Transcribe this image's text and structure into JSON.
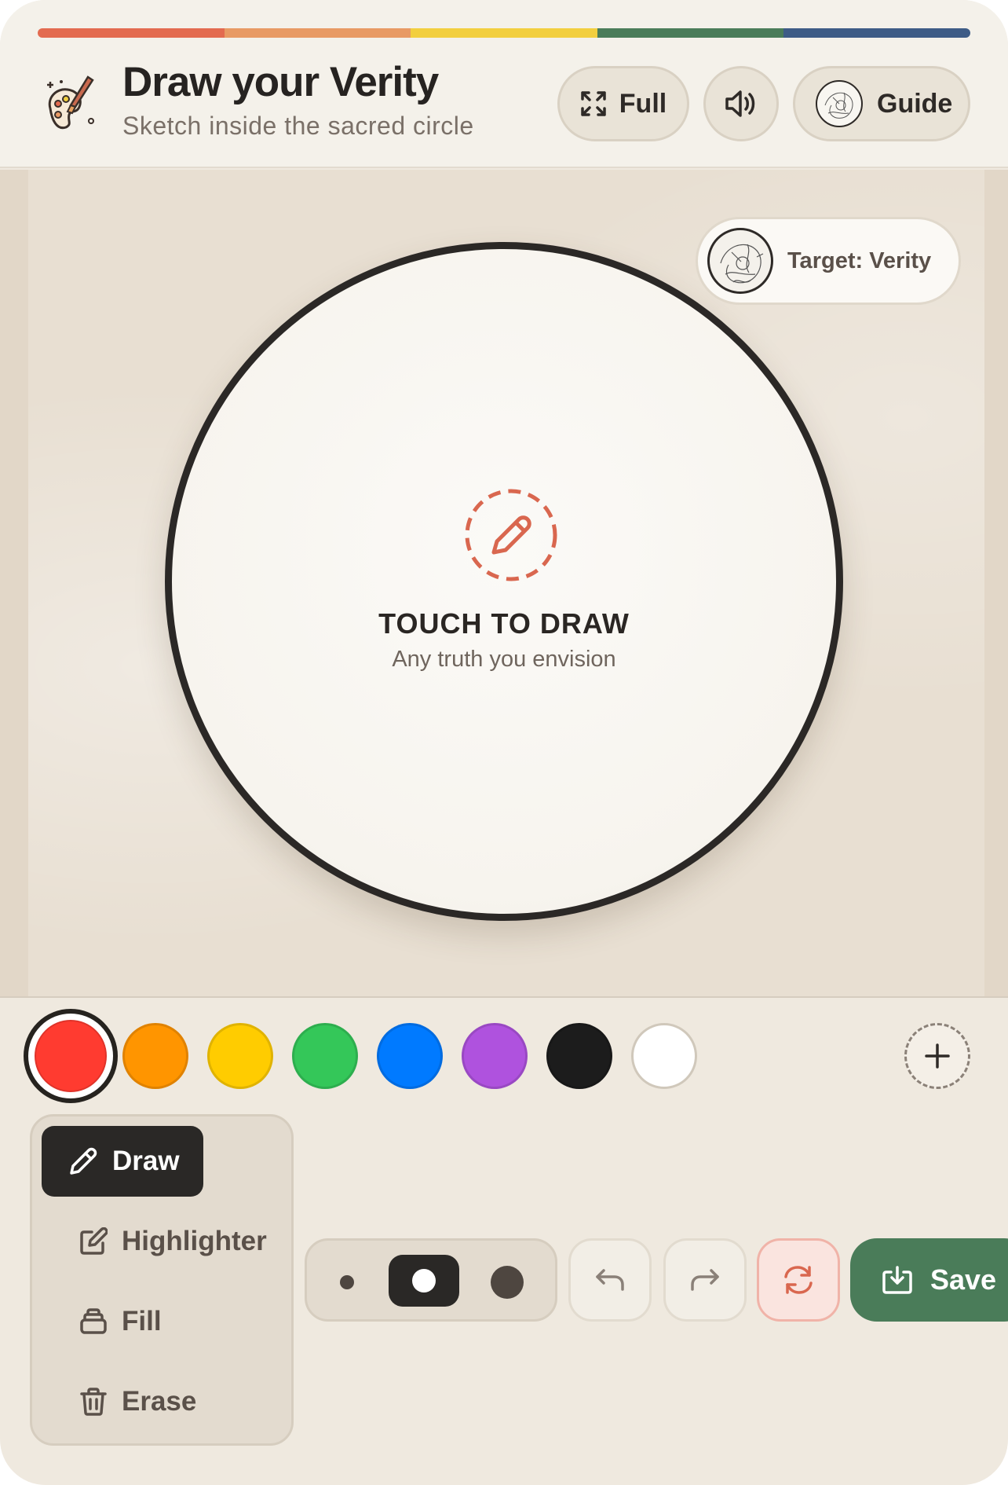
{
  "header": {
    "title": "Draw your Verity",
    "subtitle": "Sketch inside the sacred circle",
    "logo_icon": "palette-brush-icon",
    "buttons": {
      "full_label": "Full",
      "sound_icon": "speaker-icon",
      "guide_label": "Guide"
    }
  },
  "stripe_colors": [
    "#e36b50",
    "#e89a64",
    "#f2cf3f",
    "#4a7c59",
    "#3e5c86"
  ],
  "canvas": {
    "prompt_title": "TOUCH TO DRAW",
    "prompt_subtitle": "Any truth you envision",
    "prompt_icon": "pencil-icon",
    "target_label": "Target: Verity"
  },
  "palette": {
    "selected": "#ff3b30",
    "colors": [
      "#ff3b30",
      "#ff9500",
      "#ffcc00",
      "#34c759",
      "#007aff",
      "#af52de",
      "#1c1c1c",
      "#ffffff"
    ],
    "add_icon": "plus-icon"
  },
  "tools": {
    "active": "Draw",
    "items": [
      {
        "label": "Draw",
        "icon": "pencil-icon"
      },
      {
        "label": "Highlighter",
        "icon": "edit-square-icon"
      },
      {
        "label": "Fill",
        "icon": "bucket-icon"
      },
      {
        "label": "Erase",
        "icon": "trash-icon"
      }
    ]
  },
  "brush": {
    "sizes": [
      "small",
      "medium",
      "large"
    ],
    "selected": "medium"
  },
  "actions": {
    "undo_icon": "undo-icon",
    "redo_icon": "redo-icon",
    "reset_icon": "refresh-icon",
    "save_label": "Save",
    "accent": "#4a7c59"
  }
}
